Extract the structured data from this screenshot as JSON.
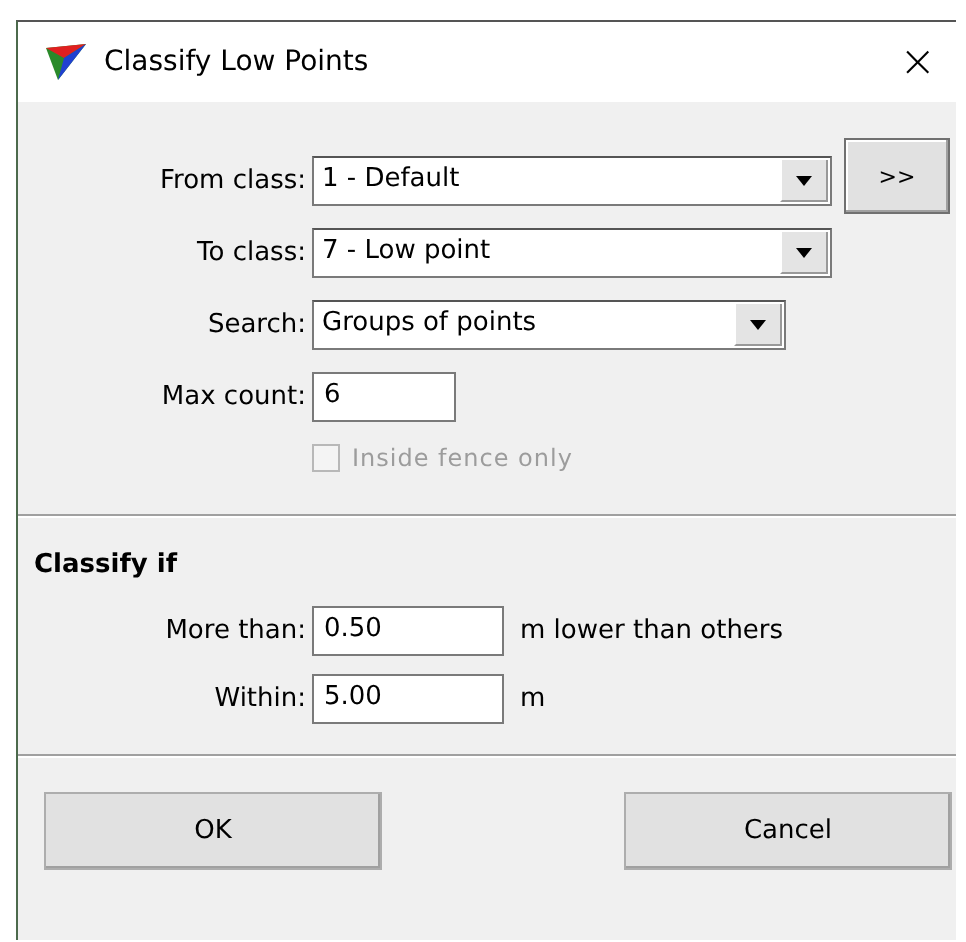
{
  "window": {
    "title": "Classify Low Points",
    "close": "×"
  },
  "from_class": {
    "label": "From class:",
    "value": "1 - Default"
  },
  "more_button": ">>",
  "to_class": {
    "label": "To class:",
    "value": "7 - Low point"
  },
  "search": {
    "label": "Search:",
    "value": "Groups of points"
  },
  "max_count": {
    "label": "Max count:",
    "value": "6"
  },
  "inside_fence": {
    "label": "Inside fence only",
    "checked": false,
    "disabled": true
  },
  "classify_if": {
    "heading": "Classify if",
    "fields": [
      {
        "label": "More than:",
        "value": "0.50",
        "unit": "m lower than others"
      },
      {
        "label": "Within:",
        "value": "5.00",
        "unit": "m"
      }
    ]
  },
  "buttons": [
    {
      "label": "OK",
      "kind": "ok"
    },
    {
      "label": "Cancel",
      "kind": "cancel"
    }
  ]
}
